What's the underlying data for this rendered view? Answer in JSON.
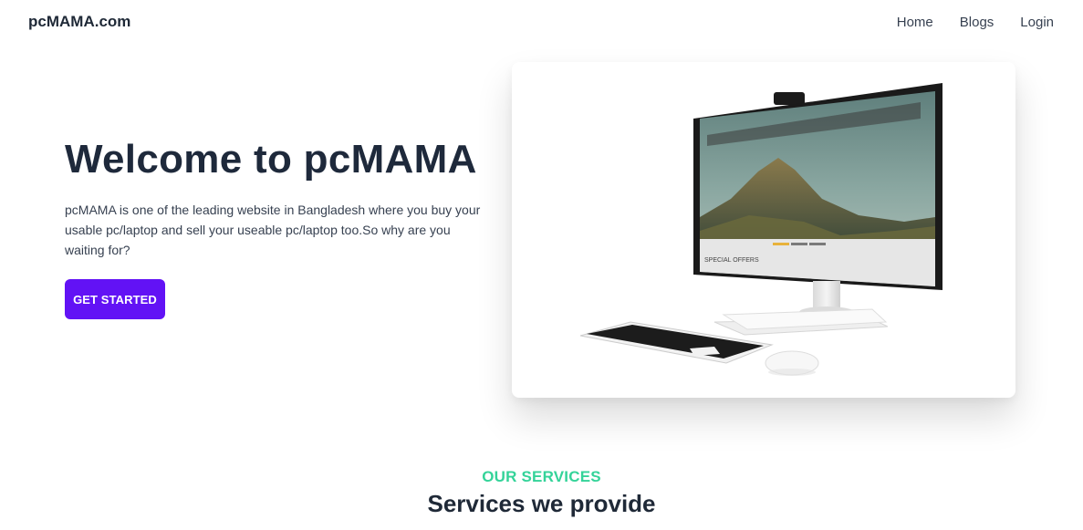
{
  "nav": {
    "brand": "pcMAMA.com",
    "links": [
      "Home",
      "Blogs",
      "Login"
    ]
  },
  "hero": {
    "title": "Welcome to pcMAMA",
    "description": "pcMAMA is one of the leading website in Bangladesh where you buy your usable pc/laptop and sell your useable pc/laptop too.So why are you waiting for?",
    "cta_label": "GET STARTED",
    "screen_caption": "SPECIAL OFFERS"
  },
  "services": {
    "kicker": "OUR SERVICES",
    "title": "Services we provide"
  },
  "colors": {
    "primary": "#6212f5",
    "accent": "#34d399",
    "heading": "#1e293b"
  }
}
